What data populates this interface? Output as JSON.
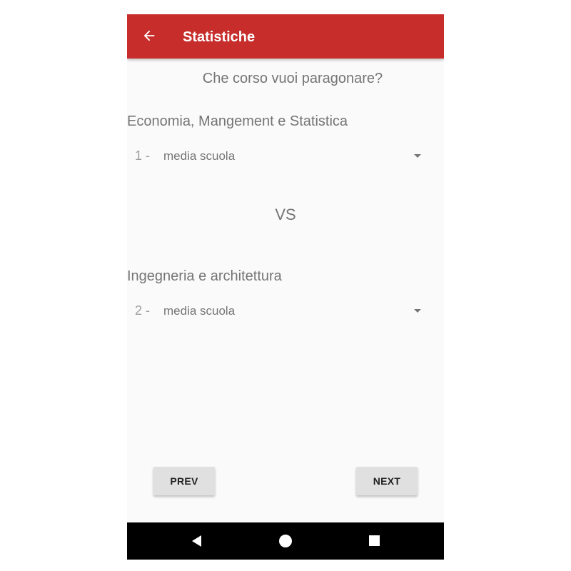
{
  "appbar": {
    "title": "Statistiche",
    "back_icon": "arrow-left-icon",
    "color": "#c62d2b"
  },
  "question": "Che corso vuoi paragonare?",
  "course1": {
    "name": "Economia, Mangement e Statistica",
    "index_label": "1 -",
    "selected": "media scuola"
  },
  "versus": "VS",
  "course2": {
    "name": "Ingegneria e architettura",
    "index_label": "2 -",
    "selected": "media scuola"
  },
  "buttons": {
    "prev": "PREV",
    "next": "NEXT"
  },
  "navbar": {
    "back": "nav-back-icon",
    "home": "nav-home-icon",
    "recents": "nav-recents-icon"
  }
}
